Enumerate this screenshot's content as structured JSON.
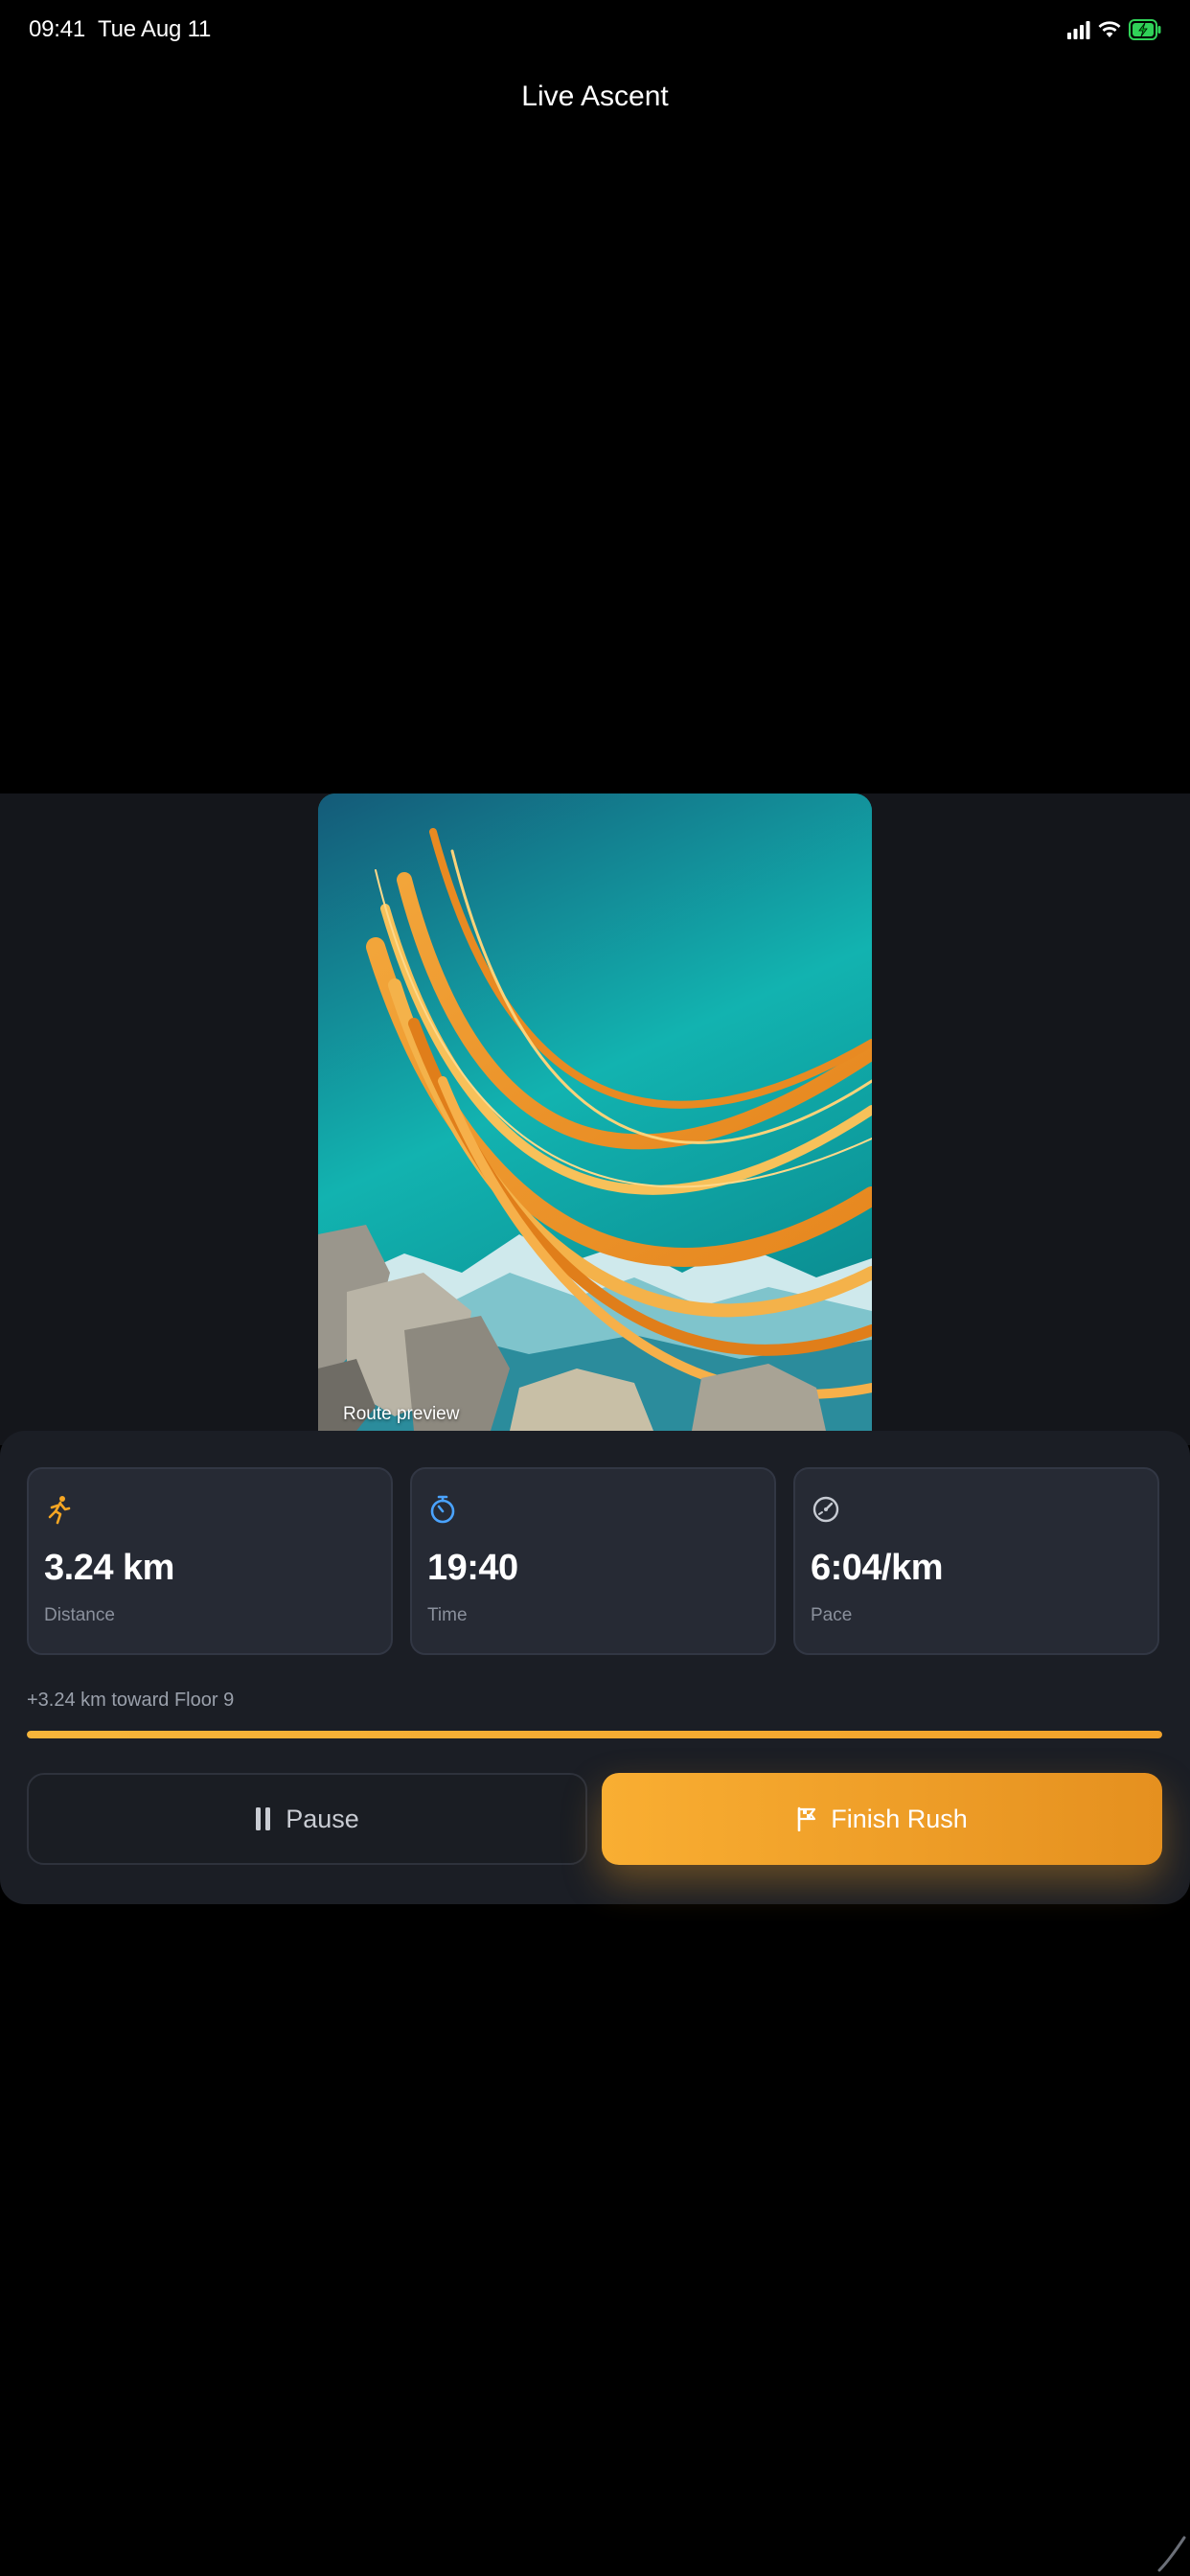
{
  "status_bar": {
    "time": "09:41",
    "date": "Tue Aug 11",
    "icons": [
      "cellular-signal-icon",
      "wifi-icon",
      "battery-charging-icon"
    ],
    "battery_color": "#30d158"
  },
  "header": {
    "title": "Live Ascent"
  },
  "preview": {
    "caption": "Route preview",
    "image": "abstract-mountain-swoosh-artwork"
  },
  "stats": [
    {
      "icon": "runner-icon",
      "value": "3.24 km",
      "label": "Distance",
      "icon_color": "#f6a623"
    },
    {
      "icon": "stopwatch-icon",
      "value": "19:40",
      "label": "Time",
      "icon_color": "#4aa3ff"
    },
    {
      "icon": "speedometer-icon",
      "value": "6:04/km",
      "label": "Pace",
      "icon_color": "#c7cbd3"
    }
  ],
  "progress": {
    "text": "+3.24 km toward Floor 9",
    "fraction": 1.0,
    "color": "#f6a623"
  },
  "actions": {
    "pause_label": "Pause",
    "finish_label": "Finish Rush"
  },
  "colors": {
    "accent": "#f6a623",
    "panel": "#1b1e25",
    "card": "#262a34"
  }
}
